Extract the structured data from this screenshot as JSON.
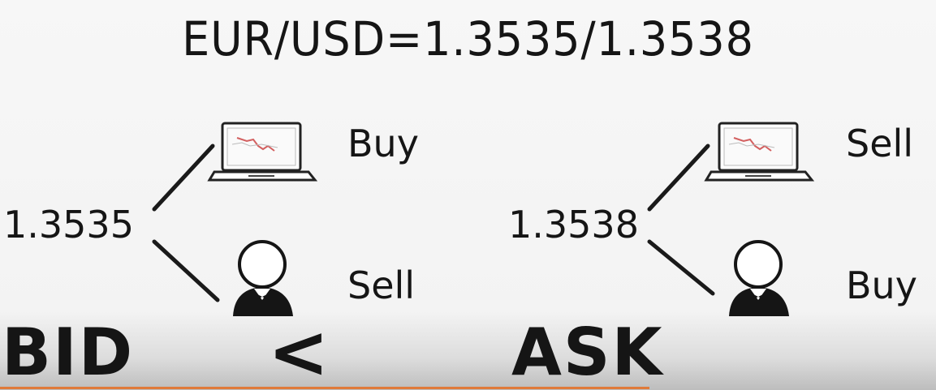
{
  "title": "EUR/USD=1.3535/1.3538",
  "bid": {
    "price": "1.3535",
    "trader_action": "Buy",
    "dealer_action": "Sell",
    "label": "BID"
  },
  "ask": {
    "price": "1.3538",
    "trader_action": "Sell",
    "dealer_action": "Buy",
    "label": "ASK"
  },
  "comparison_symbol": "<",
  "icons": {
    "trader": "laptop-icon",
    "dealer": "dealer-icon"
  }
}
